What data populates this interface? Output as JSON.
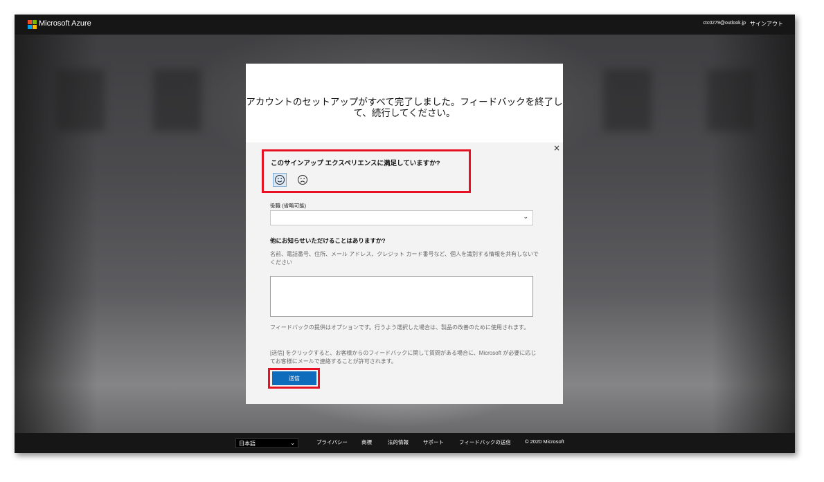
{
  "topbar": {
    "brand": "Microsoft Azure",
    "user_email": "ctc0279@outlook.jp",
    "signout_label": "サインアウト",
    "logo_colors": [
      "#f25022",
      "#7fba00",
      "#00a4ef",
      "#ffb900"
    ]
  },
  "dialog": {
    "title": "アカウントのセットアップがすべて完了しました。フィードバックを終了して、続行してください。",
    "close_icon": "×",
    "question_satisfaction": "このサインアップ エクスペリエンスに満足していますか?",
    "role_label": "役職 (省略可能)",
    "role_value": "",
    "question_more": "他にお知らせいただけることはありますか?",
    "privacy_hint": "名前、電話番号、住所、メール アドレス、クレジット カード番号など、個人を識別する情報を共有しないでください",
    "comment_value": "",
    "optional_note": "フィードバックの提供はオプションです。行うよう選択した場合は、製品の改善のために使用されます。",
    "consent_note": "[送信] をクリックすると、お客様からのフィードバックに関して質問がある場合に、Microsoft が必要に応じてお客様にメールで連絡することが許可されます。",
    "submit_label": "送信",
    "highlight_color": "#e81123",
    "accent_color": "#0f6cbd"
  },
  "footer": {
    "language": "日本語",
    "links": [
      "プライバシー",
      "商標",
      "法的情報",
      "サポート",
      "フィードバックの送信"
    ],
    "copyright": "© 2020 Microsoft"
  }
}
